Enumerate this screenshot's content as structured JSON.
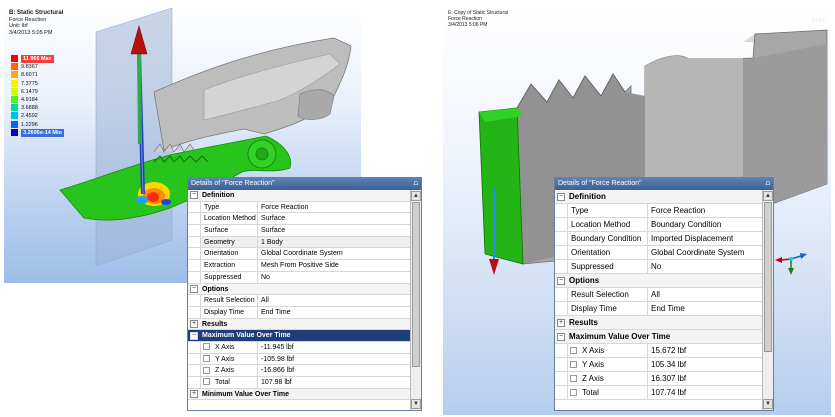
{
  "left_viewport": {
    "title_lines": [
      "B: Static Structural",
      "Force Reaction",
      "Unit: lbf",
      "3/4/2013 5:05 PM"
    ],
    "legend": [
      {
        "label": "11.866 Max",
        "color": "#ff0000",
        "tag": true
      },
      {
        "label": "9.8367",
        "color": "#ff6600"
      },
      {
        "label": "8.6071",
        "color": "#ffaa00"
      },
      {
        "label": "7.3775",
        "color": "#ffee00"
      },
      {
        "label": "6.1479",
        "color": "#c8ff00"
      },
      {
        "label": "4.9184",
        "color": "#55ee22"
      },
      {
        "label": "3.6888",
        "color": "#00dd99"
      },
      {
        "label": "2.4592",
        "color": "#00bbee"
      },
      {
        "label": "1.2296",
        "color": "#0066ff"
      },
      {
        "label": "3.2695e-14 Min",
        "color": "#0000cc",
        "tag": true
      }
    ]
  },
  "right_viewport": {
    "title_lines": [
      "E: Copy of Static Structural",
      "Force Reaction",
      "3/4/2013 5:06 PM"
    ],
    "logo": "ANSYS",
    "version": "R14.5"
  },
  "panel_left": {
    "header": "Details of \"Force Reaction\"",
    "pin": "⩍",
    "rows": [
      {
        "kind": "sec",
        "title": "Definition",
        "tog": "−"
      },
      {
        "kind": "prop",
        "label": "Type",
        "value": "Force Reaction"
      },
      {
        "kind": "prop",
        "label": "Location Method",
        "value": "Surface"
      },
      {
        "kind": "prop",
        "label": "Surface",
        "value": "Surface"
      },
      {
        "kind": "prop",
        "label": "Geometry",
        "value": "1 Body",
        "grey": true
      },
      {
        "kind": "prop",
        "label": "Orientation",
        "value": "Global Coordinate System"
      },
      {
        "kind": "prop",
        "label": "Extraction",
        "value": "Mesh From Positive Side"
      },
      {
        "kind": "prop",
        "label": "Suppressed",
        "value": "No"
      },
      {
        "kind": "sec",
        "title": "Options",
        "tog": "−"
      },
      {
        "kind": "prop",
        "label": "Result Selection",
        "value": "All"
      },
      {
        "kind": "prop",
        "label": "Display Time",
        "value": "End Time"
      },
      {
        "kind": "sec",
        "title": "Results",
        "tog": "+"
      },
      {
        "kind": "sec",
        "title": "Maximum Value Over Time",
        "tog": "−",
        "selected": true
      },
      {
        "kind": "chk",
        "label": "X Axis",
        "value": "-11.945 lbf"
      },
      {
        "kind": "chk",
        "label": "Y Axis",
        "value": "-105.98 lbf"
      },
      {
        "kind": "chk",
        "label": "Z Axis",
        "value": "-16.866 lbf"
      },
      {
        "kind": "chk",
        "label": "Total",
        "value": "107.98 lbf"
      },
      {
        "kind": "sec",
        "title": "Minimum Value Over Time",
        "tog": "+"
      }
    ]
  },
  "panel_right": {
    "header": "Details of \"Force Reaction\"",
    "pin": "⩍",
    "rows": [
      {
        "kind": "sec",
        "title": "Definition",
        "tog": "−"
      },
      {
        "kind": "prop",
        "label": "Type",
        "value": "Force Reaction"
      },
      {
        "kind": "prop",
        "label": "Location Method",
        "value": "Boundary Condition"
      },
      {
        "kind": "prop",
        "label": "Boundary Condition",
        "value": "Imported Displacement"
      },
      {
        "kind": "prop",
        "label": "Orientation",
        "value": "Global Coordinate System"
      },
      {
        "kind": "prop",
        "label": "Suppressed",
        "value": "No"
      },
      {
        "kind": "sec",
        "title": "Options",
        "tog": "−"
      },
      {
        "kind": "prop",
        "label": "Result Selection",
        "value": "All"
      },
      {
        "kind": "prop",
        "label": "Display Time",
        "value": "End Time"
      },
      {
        "kind": "sec",
        "title": "Results",
        "tog": "+"
      },
      {
        "kind": "sec",
        "title": "Maximum Value Over Time",
        "tog": "−"
      },
      {
        "kind": "chk",
        "label": "X Axis",
        "value": "15.672 lbf"
      },
      {
        "kind": "chk",
        "label": "Y Axis",
        "value": "105.34 lbf"
      },
      {
        "kind": "chk",
        "label": "Z Axis",
        "value": "16.307 lbf"
      },
      {
        "kind": "chk",
        "label": "Total",
        "value": "107.74 lbf"
      }
    ]
  }
}
